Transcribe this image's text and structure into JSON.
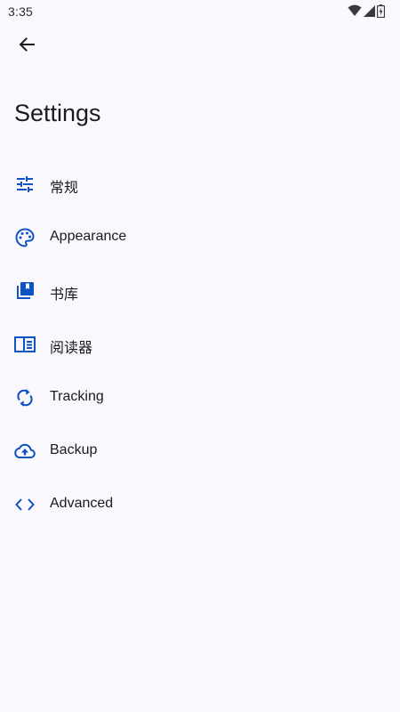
{
  "status_bar": {
    "time": "3:35",
    "icons": [
      "wifi-icon",
      "cell-signal-icon",
      "battery-icon"
    ]
  },
  "header": {
    "back_icon": "arrow-back-icon",
    "title": "Settings"
  },
  "colors": {
    "background": "#fbf8fd",
    "icon_accent": "#0d53c2",
    "text_primary": "#1b1b1f"
  },
  "settings": {
    "items": [
      {
        "label": "常规",
        "icon": "tune-icon"
      },
      {
        "label": "Appearance",
        "icon": "palette-icon"
      },
      {
        "label": "书库",
        "icon": "library-icon"
      },
      {
        "label": "阅读器",
        "icon": "reader-icon"
      },
      {
        "label": "Tracking",
        "icon": "sync-icon"
      },
      {
        "label": "Backup",
        "icon": "cloud-upload-icon"
      },
      {
        "label": "Advanced",
        "icon": "code-icon"
      }
    ]
  }
}
